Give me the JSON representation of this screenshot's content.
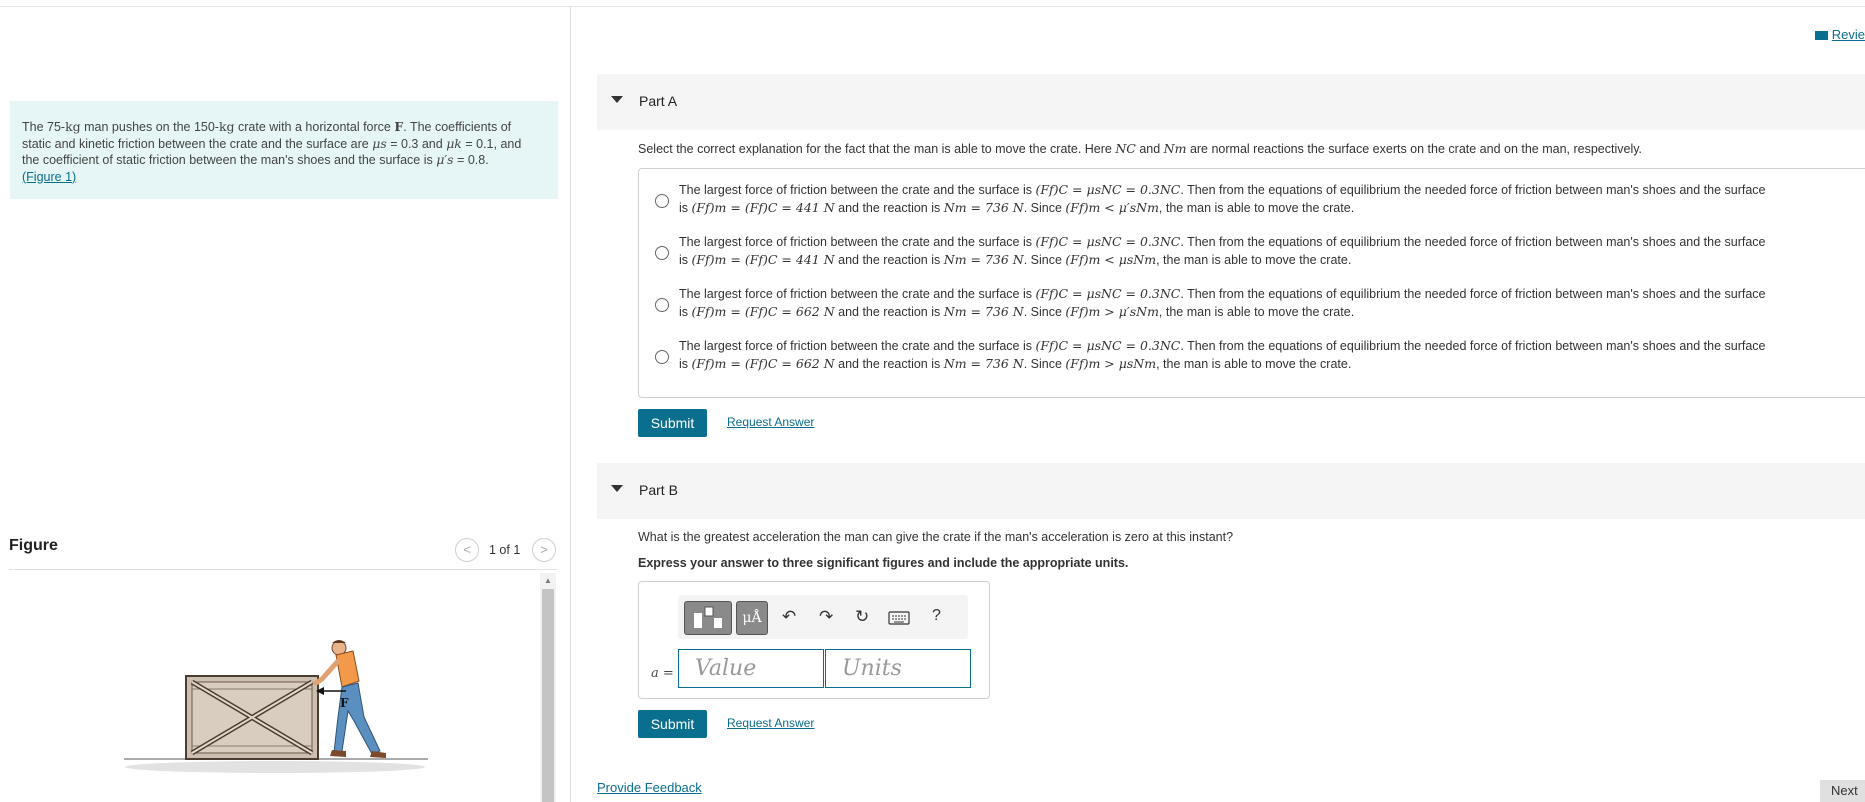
{
  "header": {
    "review_label": "Revie"
  },
  "problem": {
    "lead": "The 75-",
    "kg1": "kg",
    "t1": " man pushes on the 150-",
    "kg2": "kg",
    "t2": " crate with a horizontal force ",
    "force": "F",
    "t3": ". The coefficients of",
    "line2_a": "static and kinetic friction between the crate and the surface are ",
    "mu_s": "μs",
    "line2_b": " = 0.3 and ",
    "mu_k": "μk",
    "line2_c": " = 0.1, and",
    "line3_a": "the coefficient of static friction between the man's shoes and the surface is ",
    "mu_sp": "μ′s",
    "line3_b": " = 0.8.",
    "figure_link": "(Figure 1)"
  },
  "figure": {
    "title": "Figure",
    "pager": "1 of 1",
    "prev_glyph": "<",
    "next_glyph": ">",
    "force_label": "F"
  },
  "partA": {
    "title": "Part A",
    "question_a": "Select the correct explanation for the fact that the man is able to move the crate. Here ",
    "nc": "NC",
    "question_b": " and ",
    "nm": "Nm",
    "question_c": " are normal reactions the surface exerts on the crate and on the man, respectively.",
    "options": [
      {
        "l1_a": "The largest force of friction between the crate and the surface is ",
        "l1_eq": "(Ff)C = μsNC = 0.3NC",
        "l1_b": ". Then from the equations of equilibrium the needed force of friction between man's shoes and the surface",
        "l2_a": "is ",
        "l2_eq1": "(Ff)m = (Ff)C = 441 N",
        "l2_b": " and the reaction is ",
        "l2_eq2": "Nm = 736 N",
        "l2_c": ". Since ",
        "l2_eq3": "(Ff)m < μ′sNm",
        "l2_d": ", the man is able to move the crate."
      },
      {
        "l1_a": "The largest force of friction between the crate and the surface is ",
        "l1_eq": "(Ff)C = μsNC = 0.3NC",
        "l1_b": ". Then from the equations of equilibrium the needed force of friction between man's shoes and the surface",
        "l2_a": "is ",
        "l2_eq1": "(Ff)m = (Ff)C = 441 N",
        "l2_b": " and the reaction is ",
        "l2_eq2": "Nm = 736 N",
        "l2_c": ". Since ",
        "l2_eq3": "(Ff)m < μsNm",
        "l2_d": ", the man is able to move the crate."
      },
      {
        "l1_a": "The largest force of friction between the crate and the surface is ",
        "l1_eq": "(Ff)C = μsNC = 0.3NC",
        "l1_b": ". Then from the equations of equilibrium the needed force of friction between man's shoes and the surface",
        "l2_a": "is ",
        "l2_eq1": "(Ff)m = (Ff)C = 662 N",
        "l2_b": " and the reaction is ",
        "l2_eq2": "Nm = 736 N",
        "l2_c": ". Since ",
        "l2_eq3": "(Ff)m > μ′sNm",
        "l2_d": ", the man is able to move the crate."
      },
      {
        "l1_a": "The largest force of friction between the crate and the surface is ",
        "l1_eq": "(Ff)C = μsNC = 0.3NC",
        "l1_b": ". Then from the equations of equilibrium the needed force of friction between man's shoes and the surface",
        "l2_a": "is ",
        "l2_eq1": "(Ff)m = (Ff)C = 662 N",
        "l2_b": " and the reaction is ",
        "l2_eq2": "Nm = 736 N",
        "l2_c": ". Since ",
        "l2_eq3": "(Ff)m > μsNm",
        "l2_d": ", the man is able to move the crate."
      }
    ],
    "submit_label": "Submit",
    "request_label": "Request Answer"
  },
  "partB": {
    "title": "Part B",
    "question": "What is the greatest acceleration the man can give the crate if the man's acceleration is zero at this instant?",
    "instruction": "Express your answer to three significant figures and include the appropriate units.",
    "mu_button": "μÅ",
    "help_glyph": "?",
    "var_label": "a =",
    "value_placeholder": "Value",
    "units_placeholder": "Units",
    "submit_label": "Submit",
    "request_label": "Request Answer"
  },
  "footer": {
    "feedback_label": "Provide Feedback",
    "next_label": "Next"
  },
  "colors": {
    "accent": "#0a6e8f",
    "problem_bg": "#e6f6f6"
  }
}
